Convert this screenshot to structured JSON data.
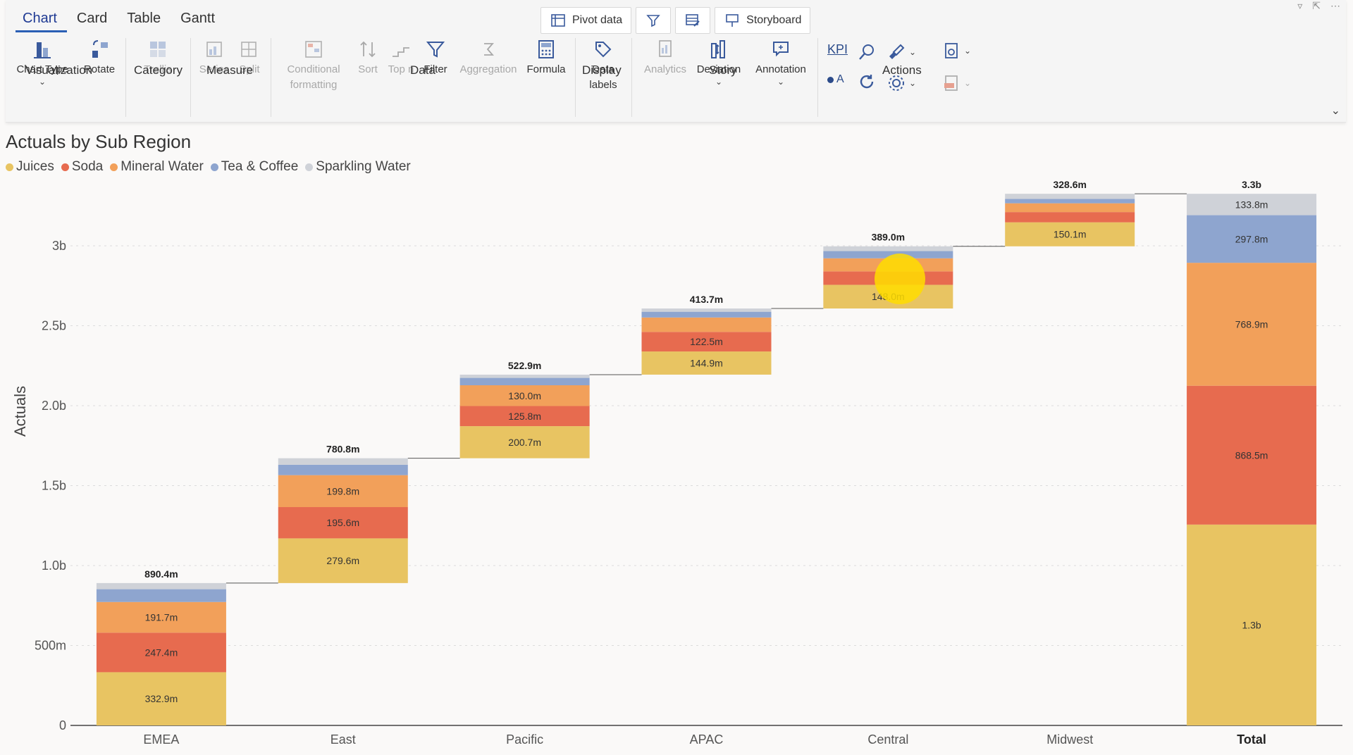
{
  "ribbon": {
    "tabs": [
      "Chart",
      "Card",
      "Table",
      "Gantt"
    ],
    "active_tab": "Chart",
    "top_buttons": {
      "pivot": "Pivot data",
      "storyboard": "Storyboard"
    },
    "buttons": {
      "chart_type": "Chart Type",
      "rotate": "Rotate",
      "trellis": "Trellis",
      "series": "Series",
      "split": "Split",
      "conditional_formatting_1": "Conditional",
      "conditional_formatting_2": "formatting",
      "sort": "Sort",
      "top_n": "Top n",
      "filter": "Filter",
      "aggregation": "Aggregation",
      "formula": "Formula",
      "data_labels_1": "Data",
      "data_labels_2": "labels",
      "analytics": "Analytics",
      "deviation": "Deviation",
      "annotation": "Annotation",
      "kpi": "KPI",
      "oa": "A"
    },
    "groups": {
      "visualization": "Visualization",
      "category": "Category",
      "measure": "Measure",
      "data": "Data",
      "display": "Display",
      "story": "Story",
      "actions": "Actions"
    }
  },
  "colors": {
    "juices": "#e8c462",
    "soda": "#e76b4f",
    "mineral_water": "#f2a05a",
    "tea_coffee": "#8ea5cf",
    "sparkling_water": "#cfd2d8",
    "accent": "#2b5fb5"
  },
  "chart_data": {
    "type": "waterfall-stacked",
    "title": "Actuals by Sub Region",
    "ylabel": "Actuals",
    "ylim": [
      0,
      3300000000
    ],
    "yticks": [
      0,
      500000000,
      1000000000,
      1500000000,
      2000000000,
      2500000000,
      3000000000
    ],
    "ytick_labels": [
      "0",
      "500m",
      "1.0b",
      "1.5b",
      "2.0b",
      "2.5b",
      "3b"
    ],
    "grid": true,
    "legend_position": "top-left",
    "legend": [
      "Juices",
      "Soda",
      "Mineral Water",
      "Tea & Coffee",
      "Sparkling Water"
    ],
    "categories": [
      "EMEA",
      "East",
      "Pacific",
      "APAC",
      "Central",
      "Midwest",
      "Total"
    ],
    "totals_labels": [
      "890.4m",
      "780.8m",
      "522.9m",
      "413.7m",
      "389.0m",
      "328.6m",
      "3.3b"
    ],
    "series": [
      {
        "name": "Juices",
        "values": [
          332.9,
          279.6,
          200.7,
          144.9,
          148.0,
          150.1,
          1256.2
        ],
        "labels": [
          "332.9m",
          "279.6m",
          "200.7m",
          "144.9m",
          "148.0m",
          "150.1m",
          "1.3b"
        ]
      },
      {
        "name": "Soda",
        "values": [
          247.4,
          195.6,
          125.8,
          122.5,
          84.0,
          64.0,
          868.5
        ],
        "labels": [
          "247.4m",
          "195.6m",
          "125.8m",
          "122.5m",
          "",
          "",
          "868.5m"
        ]
      },
      {
        "name": "Mineral Water",
        "values": [
          191.7,
          199.8,
          130.0,
          90.0,
          82.0,
          55.0,
          768.9
        ],
        "labels": [
          "191.7m",
          "199.8m",
          "130.0m",
          "",
          "",
          "",
          "768.9m"
        ]
      },
      {
        "name": "Tea & Coffee",
        "values": [
          80.0,
          65.0,
          46.0,
          36.0,
          45.0,
          27.0,
          297.8
        ],
        "labels": [
          "",
          "",
          "",
          "",
          "",
          "",
          "297.8m"
        ]
      },
      {
        "name": "Sparkling Water",
        "values": [
          38.4,
          40.8,
          20.4,
          20.3,
          30.0,
          32.5,
          133.8
        ],
        "labels": [
          "",
          "",
          "",
          "",
          "",
          "",
          "133.8m"
        ]
      }
    ],
    "units": "millions",
    "bold_categories": [
      "Total"
    ]
  }
}
